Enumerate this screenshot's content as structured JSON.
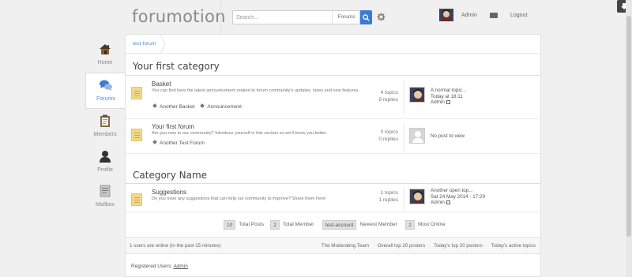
{
  "header": {
    "logo": "forumotion",
    "search_placeholder": "Search...",
    "search_scope": "Forums",
    "user": "Admin",
    "logout": "Logout"
  },
  "nav": {
    "items": [
      {
        "label": "Home",
        "icon": "home-icon"
      },
      {
        "label": "Forums",
        "icon": "chat-bubbles-icon",
        "active": true
      },
      {
        "label": "Members",
        "icon": "clipboard-icon"
      },
      {
        "label": "Profile",
        "icon": "user-silhouette-icon"
      },
      {
        "label": "Mailbox",
        "icon": "mailbox-icon"
      }
    ]
  },
  "breadcrumb": {
    "root": "test-forum"
  },
  "categories": [
    {
      "title": "Your first category",
      "forums": [
        {
          "name": "Basket",
          "description": "You can find here the latest announcement related to forum community's updates, news and new features.",
          "subforums": [
            "Another Basket",
            "Announcement"
          ],
          "topics": "4 topics",
          "replies": "9 replies",
          "last_post": {
            "title": "A normal topic...",
            "date": "Today at 18:11",
            "author": "Admin"
          }
        },
        {
          "name": "Your first forum",
          "description": "Are you new to our community? Introduce yourself in this section so we'll know you better.",
          "subforums": [
            "Another Test Forum"
          ],
          "topics": "0 topics",
          "replies": "0 replies",
          "last_post": {
            "empty": "No post to view"
          }
        }
      ]
    },
    {
      "title": "Category Name",
      "forums": [
        {
          "name": "Suggestions",
          "description": "Do you have any suggestions that can help our community to improve? Share them here!",
          "topics": "1 topics",
          "replies": "1 replies",
          "last_post": {
            "title": "Another open top...",
            "date": "Sat 24 May 2014 - 17:29",
            "author": "Admin"
          }
        }
      ]
    }
  ],
  "stats": {
    "total_posts_value": "10",
    "total_posts_label": "Total Posts",
    "total_member_value": "2",
    "total_member_label": "Total Member",
    "newest_member_value": "test-account",
    "newest_member_label": "Newest Member",
    "most_online_value": "2",
    "most_online_label": "Most Online"
  },
  "online": {
    "text": "1 users are online (in the past 15 minutes)",
    "links": [
      "The Moderating Team",
      "Overall top 20 posters",
      "Today's top 20 posters",
      "Today's active topics"
    ]
  },
  "registered": {
    "label": "Registered Users:",
    "user": "Admin"
  },
  "colors": {
    "accent": "#3a7bd5",
    "link": "#4a8fd8"
  }
}
